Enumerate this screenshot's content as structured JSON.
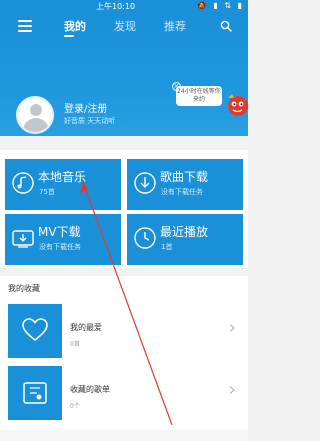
{
  "status_bar": {
    "time": "上午10:10",
    "icons": "🔕 ▮ ⇅ ▮"
  },
  "header": {
    "tabs": [
      {
        "label": "我的"
      },
      {
        "label": "发现"
      },
      {
        "label": "推荐"
      }
    ],
    "login": {
      "label": "登录/注册",
      "subtitle": "好音质 天天动听"
    },
    "kefu": {
      "text": "24小时在线等你来约",
      "close": "×"
    }
  },
  "grid": {
    "tiles": [
      {
        "title": "本地音乐",
        "sub": "75首"
      },
      {
        "title": "歌曲下载",
        "sub": "没有下载任务"
      },
      {
        "title": "MV下载",
        "sub": "没有下载任务"
      },
      {
        "title": "最近播放",
        "sub": "1首"
      }
    ]
  },
  "collection": {
    "title": "我的收藏",
    "rows": [
      {
        "title": "我的最爱",
        "sub": "0首"
      },
      {
        "title": "收藏的歌单",
        "sub": "0个"
      }
    ]
  },
  "colors": {
    "primary": "#1a90d9",
    "annotation": "#e23b2e"
  },
  "annotation": {
    "arrow_present": true
  }
}
